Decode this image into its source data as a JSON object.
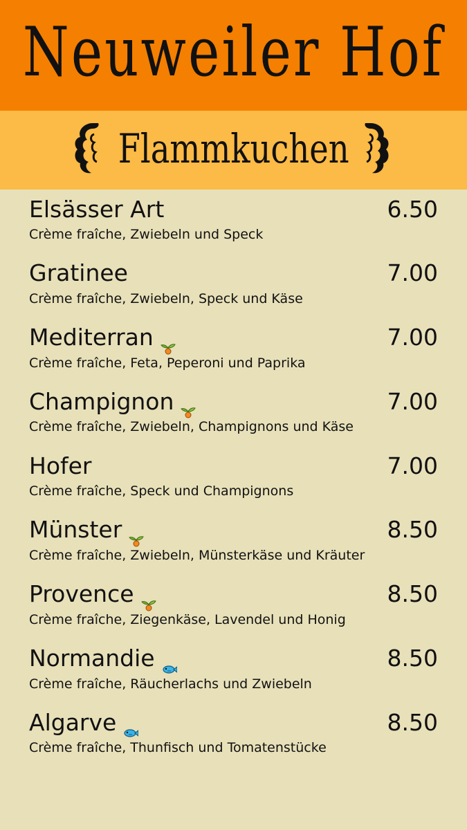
{
  "header": {
    "title": "Neuweiler Hof"
  },
  "section": {
    "title": "Flammkuchen"
  },
  "items": [
    {
      "name": "Elsässer Art",
      "price": "6.50",
      "desc": "Crème fraîche, Zwiebeln und Speck",
      "icon": ""
    },
    {
      "name": "Gratinee",
      "price": "7.00",
      "desc": "Crème fraîche, Zwiebeln, Speck und Käse",
      "icon": ""
    },
    {
      "name": "Mediterran",
      "price": "7.00",
      "desc": "Crème fraîche, Feta, Peperoni und Paprika",
      "icon": "vegetarian-icon"
    },
    {
      "name": "Champignon",
      "price": "7.00",
      "desc": "Crème fraîche, Zwiebeln, Champignons und Käse",
      "icon": "vegetarian-icon"
    },
    {
      "name": "Hofer",
      "price": "7.00",
      "desc": "Crème fraîche, Speck und Champignons",
      "icon": ""
    },
    {
      "name": "Münster",
      "price": "8.50",
      "desc": "Crème fraîche, Zwiebeln, Münsterkäse und Kräuter",
      "icon": "vegetarian-icon"
    },
    {
      "name": "Provence",
      "price": "8.50",
      "desc": "Crème fraîche, Ziegenkäse, Lavendel und Honig",
      "icon": "vegetarian-icon"
    },
    {
      "name": "Normandie",
      "price": "8.50",
      "desc": "Crème fraîche, Räucherlachs und Zwiebeln",
      "icon": "fish-icon"
    },
    {
      "name": "Algarve",
      "price": "8.50",
      "desc": "Crème fraîche, Thunfisch und Tomatenstücke",
      "icon": "fish-icon"
    }
  ],
  "colors": {
    "header": "#f57f00",
    "subheader": "#fcba46",
    "background": "#e8e0b9"
  }
}
